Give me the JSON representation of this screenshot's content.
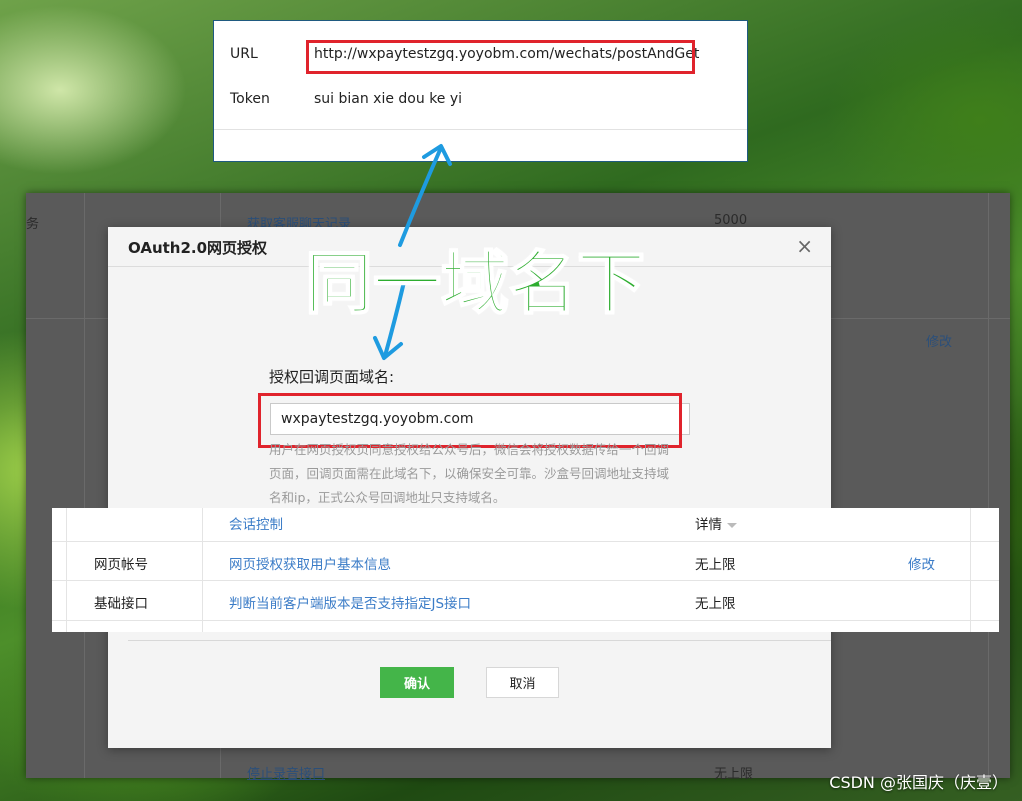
{
  "top_card": {
    "url_label": "URL",
    "url_value": "http://wxpaytestzgq.yoyobm.com/wechats/postAndGet",
    "token_label": "Token",
    "token_value": "sui bian xie dou ke yi"
  },
  "background_list": {
    "row1_left": "务",
    "row1_link": "获取客服聊天记录",
    "row1_value": "5000",
    "row2_action": "修改",
    "last_link": "停止录音接口",
    "last_value": "无上限"
  },
  "modal": {
    "title": "OAuth2.0网页授权",
    "close_symbol": "×",
    "field_label": "授权回调页面域名:",
    "domain_value": "wxpaytestzgq.yoyobm.com",
    "hint": "用户在网页授权页同意授权给公众号后，微信会将授权数据传给一个回调页面，回调页面需在此域名下，以确保安全可靠。沙盒号回调地址支持域名和ip，正式公众号回调地址只支持域名。",
    "confirm_label": "确认",
    "cancel_label": "取消"
  },
  "overlay_table": {
    "header_link": "会话控制",
    "header_col": "详情",
    "rows": [
      {
        "category": "网页帐号",
        "name": "网页授权获取用户基本信息",
        "limit": "无上限",
        "action": "修改"
      },
      {
        "category": "基础接口",
        "name": "判断当前客户端版本是否支持指定JS接口",
        "limit": "无上限",
        "action": ""
      }
    ]
  },
  "annotation": {
    "caption": "同一域名下",
    "highlight_color": "#e0232c",
    "caption_color": "#2dad2f",
    "arrow_color": "#1e9be0"
  },
  "watermark": "CSDN @张国庆（庆壹）"
}
